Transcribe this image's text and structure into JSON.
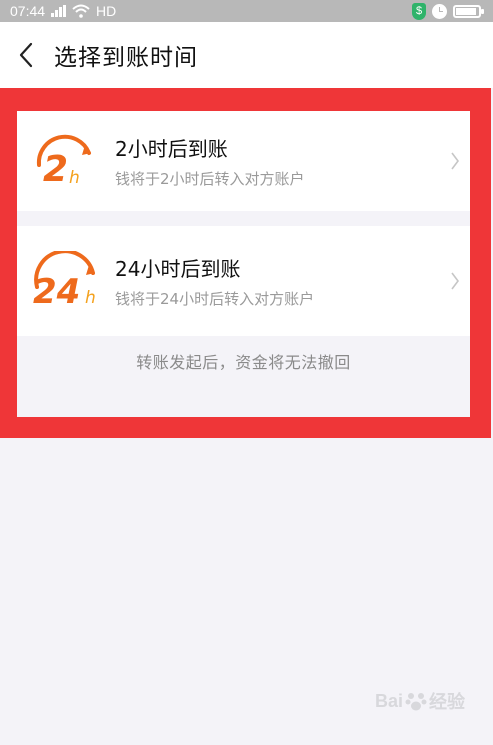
{
  "status_bar": {
    "time": "07:44",
    "network": "HD",
    "icons": [
      "signal-icon",
      "wifi-icon",
      "shield-icon",
      "alarm-icon",
      "battery-icon"
    ]
  },
  "nav": {
    "title": "选择到账时间",
    "back_icon": "chevron-left-icon"
  },
  "options": [
    {
      "badge_number": "2",
      "badge_unit": "h",
      "title": "2小时后到账",
      "description": "钱将于2小时后转入对方账户"
    },
    {
      "badge_number": "24",
      "badge_unit": "h",
      "title": "24小时后到账",
      "description": "钱将于24小时后转入对方账户"
    }
  ],
  "notice": "转账发起后，资金将无法撤回",
  "watermark": {
    "text": "Bai",
    "text2": "经验"
  },
  "colors": {
    "highlight": "#ef3638",
    "badge_orange": "#ee6a1c",
    "badge_yellow": "#f4a21f",
    "page_bg": "#f4f3f8"
  }
}
